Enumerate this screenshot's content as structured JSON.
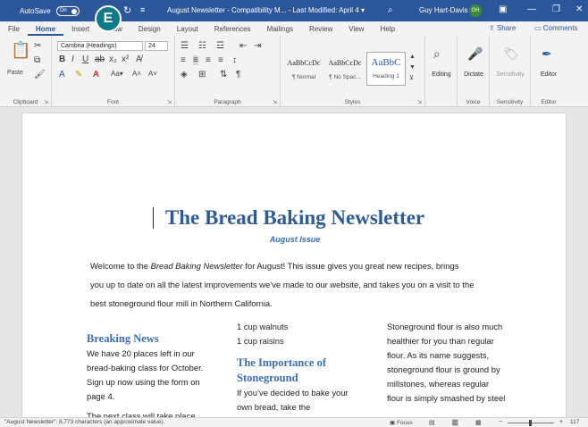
{
  "titlebar": {
    "autosave_label": "AutoSave",
    "toggle_label": "On",
    "callout_letter": "E",
    "document_title": "August Newsletter - Compatibility M... - Last Modified: April 4 ▾",
    "user_name": "Guy Hart-Davis",
    "user_initials": "GH",
    "minimize": "—",
    "restore": "❐",
    "close": "✕"
  },
  "tabs": [
    "File",
    "Home",
    "Insert",
    "Draw",
    "Design",
    "Layout",
    "References",
    "Mailings",
    "Review",
    "View",
    "Help"
  ],
  "active_tab": "Home",
  "share_label": "Share",
  "comments_label": "Comments",
  "ribbon": {
    "clipboard": {
      "label": "Clipboard",
      "paste": "Paste"
    },
    "font": {
      "label": "Font",
      "font_name": "Cambria (Headings)",
      "font_size": "24"
    },
    "paragraph": {
      "label": "Paragraph"
    },
    "styles": {
      "label": "Styles",
      "items": [
        {
          "sample": "AaBbCcDc",
          "name": "¶ Normal"
        },
        {
          "sample": "AaBbCcDc",
          "name": "¶ No Spac..."
        },
        {
          "sample": "AaBbC",
          "name": "Heading 1"
        }
      ]
    },
    "editing": {
      "label": "Editing"
    },
    "voice": {
      "label": "Voice",
      "dictate": "Dictate"
    },
    "sensitivity": {
      "label": "Sensitivity",
      "button": "Sensitivity"
    },
    "editor": {
      "label": "Editor",
      "button": "Editor"
    }
  },
  "document": {
    "title": "The Bread Baking Newsletter",
    "subtitle": "August Issue",
    "intro_1": "Welcome to the ",
    "intro_italic": "Bread Baking Newsletter",
    "intro_2": " for August! This issue gives you great new recipes, brings you up to date on all the latest improvements we’ve made to our website, and takes you on a visit to the best stoneground flour mill in Northern California.",
    "col1_heading": "Breaking News",
    "col1_p1": "We have 20 places left in our bread-baking class for October. Sign up now using the form on page 4.",
    "col1_p2": "The next class will take place",
    "col2_line1": "1 cup walnuts",
    "col2_line2": "1 cup raisins",
    "col2_heading": "The Importance of Stoneground",
    "col2_p1": "If you’ve decided to bake your own bread, take the",
    "col3_p1": "Stoneground flour is also much healthier for you than regular flour. As its name suggests, stoneground flour is ground by millstones, whereas regular flour is simply smashed by steel"
  },
  "status": {
    "word_count": "\"August Newsletter\": 8,773 characters (an approximate value).",
    "focus": "Focus",
    "zoom_minus": "−",
    "zoom_plus": "+",
    "zoom_level": "117"
  }
}
